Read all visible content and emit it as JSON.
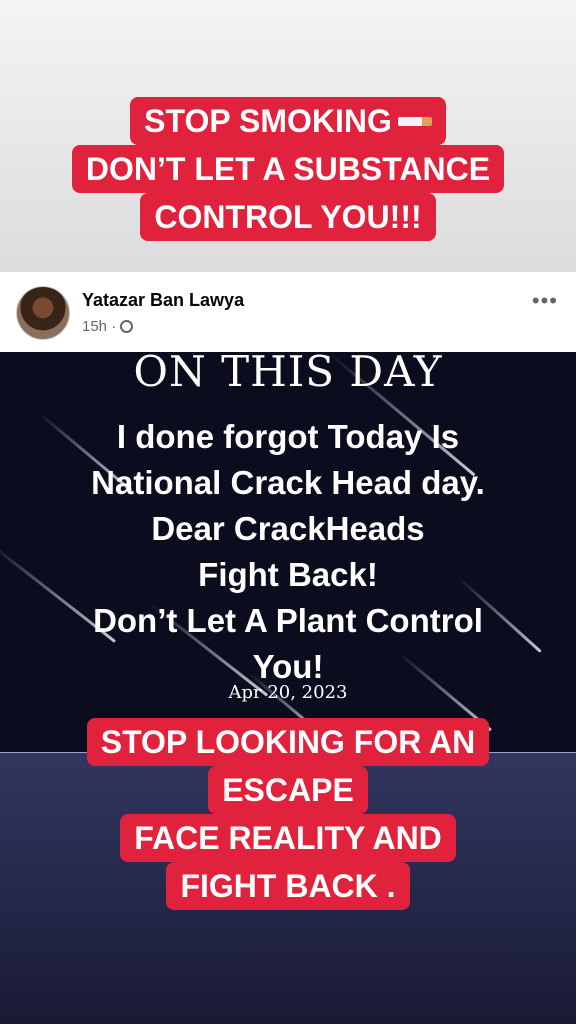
{
  "top_caption": {
    "lines": [
      "STOP SMOKING",
      "DON’T LET A SUBSTANCE",
      "CONTROL YOU!!!"
    ],
    "emoji": "cigarette-icon"
  },
  "post": {
    "author": "Yatazar Ban Lawya",
    "time": "15h",
    "separator": "·",
    "privacy_icon": "globe-icon",
    "more": "•••",
    "image": {
      "header": "ON THIS DAY",
      "lines": [
        "I done forgot Today Is",
        "National Crack Head day.",
        "Dear CrackHeads",
        "Fight Back!",
        "Don’t Let A Plant Control",
        "You!"
      ],
      "date": "Apr 20, 2023"
    }
  },
  "bottom_caption": {
    "lines": [
      "STOP LOOKING FOR AN",
      "ESCAPE",
      "FACE REALITY AND",
      "FIGHT BACK ."
    ]
  },
  "colors": {
    "caption_bg": "#e0223c",
    "post_image_bg": "#0b0c1e"
  }
}
